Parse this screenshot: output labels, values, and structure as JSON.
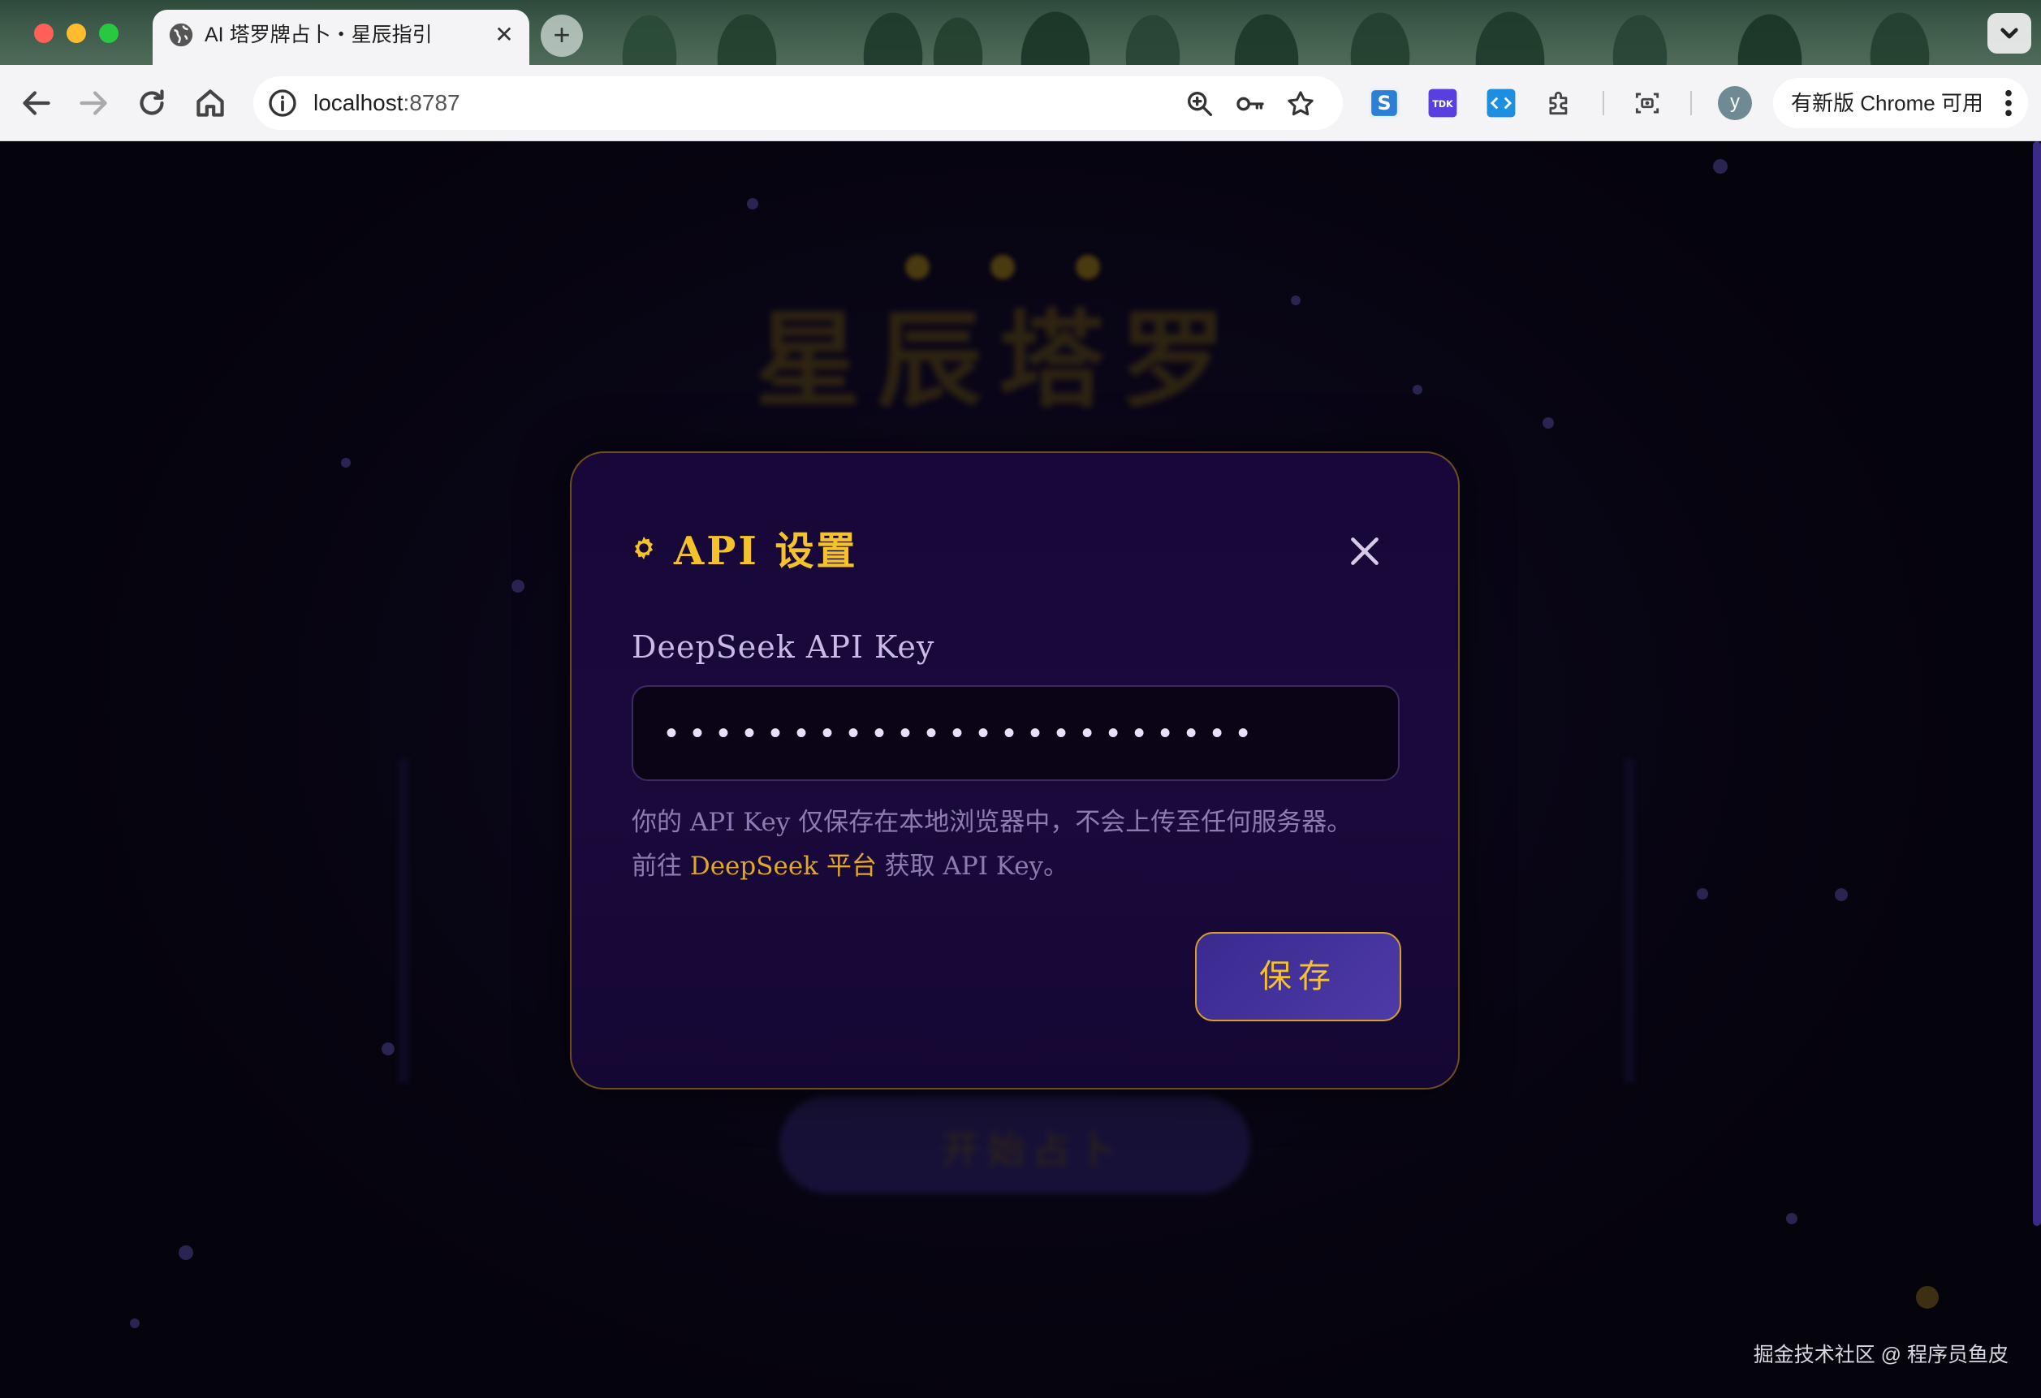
{
  "browser": {
    "tab_title": "AI 塔罗牌占卜・星辰指引",
    "tab_close": "✕",
    "new_tab": "+",
    "url_host": "localhost",
    "url_port": ":8787",
    "profile_initial": "y",
    "update_label": "有新版 Chrome 可用",
    "extensions": [
      {
        "name": "sogou-extension-icon",
        "label": "S",
        "color": "#2a7fd6"
      },
      {
        "name": "tdk-extension-icon",
        "label": "TDK",
        "color": "#5a3fe0"
      },
      {
        "name": "code-extension-icon",
        "label": "<·>",
        "color": "#1e8fe0"
      }
    ]
  },
  "background": {
    "title": "星辰塔罗",
    "button_label": "开始占卜"
  },
  "modal": {
    "title": "API 设置",
    "field_label": "DeepSeek API Key",
    "input_value": "•••••••••••••••••••••••",
    "hint_line1": "你的 API Key 仅保存在本地浏览器中，不会上传至任何服务器。",
    "hint_prefix": "前往 ",
    "hint_link": "DeepSeek 平台",
    "hint_suffix": " 获取 API Key。",
    "save_label": "保存",
    "accent_color": "#f4c22a"
  },
  "watermark": "掘金技术社区 @ 程序员鱼皮"
}
